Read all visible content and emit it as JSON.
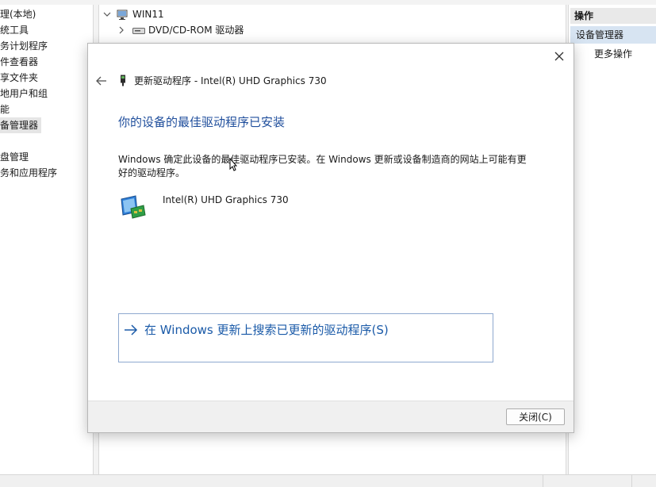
{
  "left_tree": {
    "items": [
      {
        "label": "管理(本地)",
        "selected": false
      },
      {
        "label": "系统工具",
        "selected": false
      },
      {
        "label": "任务计划程序",
        "selected": false
      },
      {
        "label": "事件查看器",
        "selected": false
      },
      {
        "label": "共享文件夹",
        "selected": false
      },
      {
        "label": "本地用户和组",
        "selected": false
      },
      {
        "label": "性能",
        "selected": false
      },
      {
        "label": "设备管理器",
        "selected": true
      },
      {
        "label": "磁盘管理",
        "selected": false
      },
      {
        "label": "服务和应用程序",
        "selected": false
      }
    ]
  },
  "device_tree": {
    "root_label": "WIN11",
    "first_child_label": "DVD/CD-ROM 驱动器"
  },
  "actions_pane": {
    "header": "操作",
    "section": "设备管理器",
    "more": "更多操作"
  },
  "dialog": {
    "title": "更新驱动程序 - Intel(R) UHD Graphics 730",
    "heading": "你的设备的最佳驱动程序已安装",
    "description": "Windows 确定此设备的最佳驱动程序已安装。在 Windows 更新或设备制造商的网站上可能有更好的驱动程序。",
    "device_name": "Intel(R) UHD Graphics 730",
    "search_link": "在 Windows 更新上搜索已更新的驱动程序(S)",
    "close_button": "关闭(C)"
  },
  "colors": {
    "heading": "#1f4e9c",
    "link": "#1a5aa8",
    "selection": "#d7e4f2"
  }
}
